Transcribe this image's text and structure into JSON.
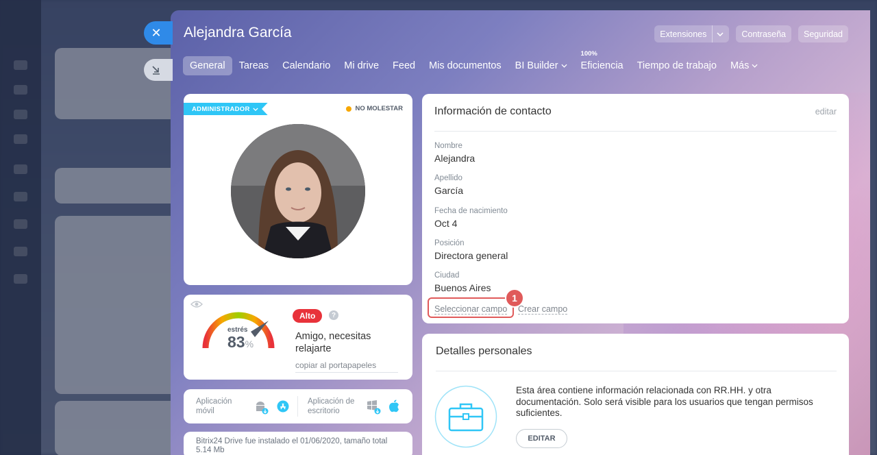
{
  "panel": {
    "title": "Alejandra García",
    "buttons": {
      "extensions": "Extensiones",
      "password": "Contraseña",
      "security": "Seguridad"
    }
  },
  "tabs": [
    {
      "label": "General",
      "active": true
    },
    {
      "label": "Tareas"
    },
    {
      "label": "Calendario"
    },
    {
      "label": "Mi drive"
    },
    {
      "label": "Feed"
    },
    {
      "label": "Mis documentos"
    },
    {
      "label": "BI Builder"
    },
    {
      "label": "Eficiencia",
      "top_label": "100%"
    },
    {
      "label": "Tiempo de trabajo"
    },
    {
      "label": "Más"
    }
  ],
  "profile": {
    "role_badge": "ADMINISTRADOR",
    "status": "NO MOLESTAR",
    "status_color": "#f7a700"
  },
  "stress": {
    "label": "estrés",
    "value": "83",
    "unit": "%",
    "level": "Alto",
    "level_color": "#e8323a",
    "message": "Amigo, necesitas relajarte",
    "copy": "copiar al portapapeles"
  },
  "apps": {
    "mobile_label": "Aplicación móvil",
    "desktop_label": "Aplicación de escritorio"
  },
  "drive": {
    "text": "Bitrix24 Drive fue instalado el 01/06/2020, tamaño total 5.14 Mb"
  },
  "contact": {
    "title": "Información de contacto",
    "edit": "editar",
    "fields": [
      {
        "label": "Nombre",
        "value": "Alejandra"
      },
      {
        "label": "Apellido",
        "value": "García"
      },
      {
        "label": "Fecha de nacimiento",
        "value": "Oct 4"
      },
      {
        "label": "Posición",
        "value": "Directora general"
      },
      {
        "label": "Ciudad",
        "value": "Buenos Aires"
      }
    ],
    "select_field": "Seleccionar campo",
    "create_field": "Crear campo",
    "callout_number": "1"
  },
  "personal": {
    "title": "Detalles personales",
    "description": "Esta área contiene información relacionada con RR.HH. y otra documentación. Solo será visible para los usuarios que tengan permisos suficientes.",
    "edit_button": "EDITAR"
  },
  "colors": {
    "accent": "#2fc6f6",
    "close_button": "#2f8ae8",
    "highlight": "#e05a5a"
  }
}
